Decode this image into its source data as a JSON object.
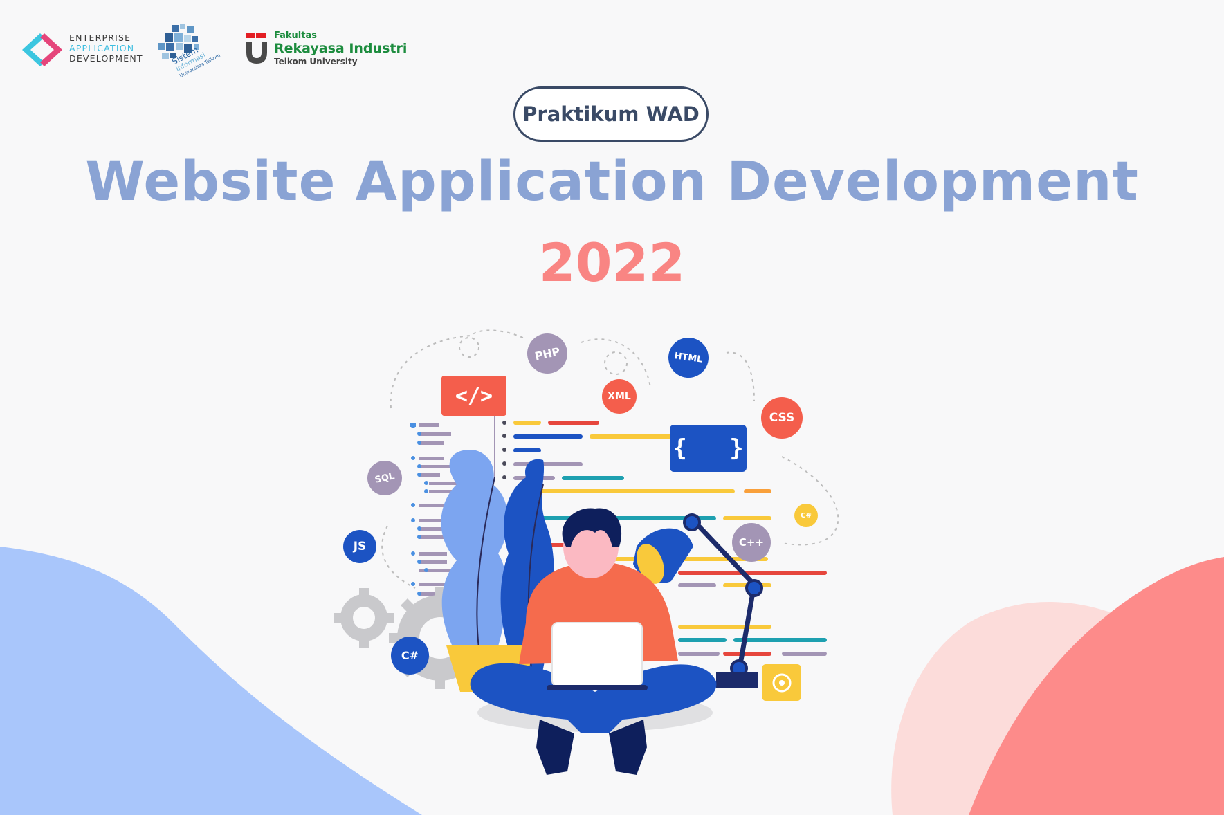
{
  "logos": {
    "ead": {
      "line1": "ENTERPRISE",
      "line2": "APPLICATION",
      "line3": "DEVELOPMENT"
    },
    "si": {
      "line1": "Sistem",
      "line2": "Informasi",
      "line3": "Universitas Telkom"
    },
    "fri": {
      "line1": "Fakultas",
      "line2": "Rekayasa Industri",
      "line3": "Telkom University"
    }
  },
  "badge": {
    "label": "Praktikum WAD"
  },
  "hero": {
    "title": "Website Application Development",
    "year": "2022"
  },
  "tech_bubbles": {
    "php": "PHP",
    "html": "HTML",
    "xml": "XML",
    "css": "CSS",
    "sql": "SQL",
    "js": "JS",
    "cpp": "C++",
    "csharp": "C#",
    "csharp_small": "C#"
  },
  "code_icon": "</>",
  "braces_icon": "{   }",
  "colors": {
    "title": "#8aa3d4",
    "year": "#f98583",
    "badge_border": "#3a4a66",
    "blob_left": "#a9c6fb",
    "blob_right": "#fd8b8a",
    "blob_right_light": "#fcdcda"
  }
}
